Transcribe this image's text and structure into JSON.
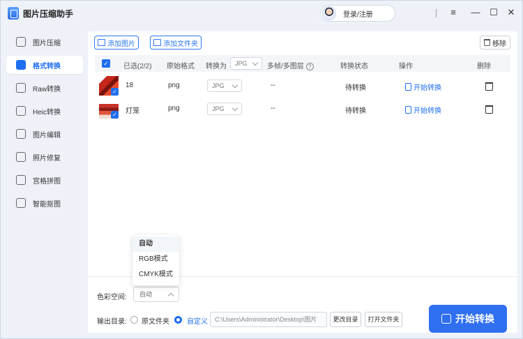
{
  "app": {
    "title": "图片压缩助手"
  },
  "account": {
    "login_label": "登录/注册"
  },
  "window_controls": {
    "menu": "≡",
    "minimize": "—",
    "maximize": "☐",
    "close": "✕"
  },
  "sidebar": {
    "items": [
      {
        "label": "图片压缩",
        "icon": "image-compress-icon",
        "active": false
      },
      {
        "label": "格式转换",
        "icon": "format-convert-icon",
        "active": true
      },
      {
        "label": "Raw转换",
        "icon": "raw-convert-icon",
        "active": false
      },
      {
        "label": "Heic转换",
        "icon": "heic-convert-icon",
        "active": false
      },
      {
        "label": "图片编辑",
        "icon": "image-edit-icon",
        "active": false
      },
      {
        "label": "照片修复",
        "icon": "photo-repair-icon",
        "active": false
      },
      {
        "label": "宫格拼图",
        "icon": "grid-collage-icon",
        "active": false
      },
      {
        "label": "智能抠图",
        "icon": "smart-cutout-icon",
        "active": false
      }
    ]
  },
  "toolbar": {
    "add_image": "添加图片",
    "add_folder": "添加文件夹",
    "remove": "移除"
  },
  "table": {
    "headers": {
      "selected": "已选(2/2)",
      "original_format": "原始格式",
      "convert_to": "转换为",
      "convert_to_value": "JPG",
      "multi_frame": "多帧/多图层",
      "status": "转换状态",
      "action": "操作",
      "delete": "删除"
    },
    "rows": [
      {
        "name": "18",
        "format": "png",
        "target": "JPG",
        "frames": "--",
        "status": "待转换",
        "action": "开始转换"
      },
      {
        "name": "灯笼",
        "format": "png",
        "target": "JPG",
        "frames": "--",
        "status": "待转换",
        "action": "开始转换"
      }
    ]
  },
  "color_space": {
    "label": "色彩空间:",
    "value": "自动",
    "options": [
      "自动",
      "RGB模式",
      "CMYK模式"
    ],
    "selected_index": 0
  },
  "output": {
    "label": "输出目录:",
    "option_original": "原文件夹",
    "option_custom": "自定义",
    "selected": "custom",
    "path": "C:\\Users\\Administrator\\Desktop\\图片",
    "change_dir": "更改目录",
    "open_folder": "打开文件夹"
  },
  "start_button": "开始转换",
  "colors": {
    "accent": "#2f6ff0",
    "sidebar_bg": "#eef2f8"
  }
}
